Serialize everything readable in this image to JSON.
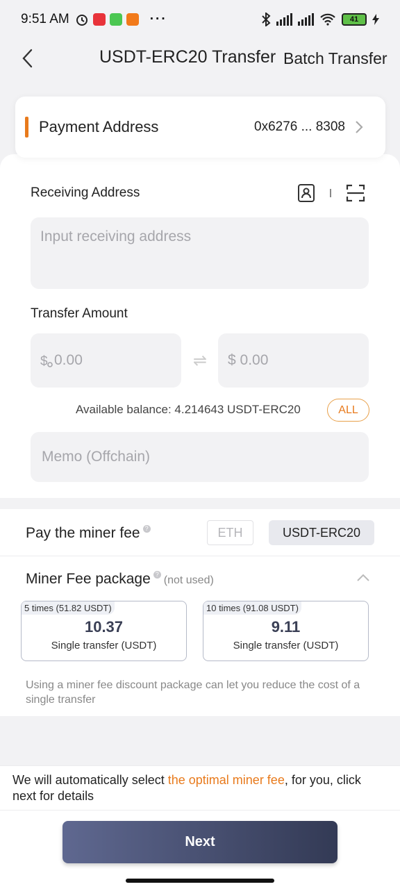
{
  "status_bar": {
    "time": "9:51 AM",
    "battery": "41"
  },
  "header": {
    "title": "USDT-ERC20 Transfer",
    "batch_transfer": "Batch Transfer"
  },
  "payment": {
    "label": "Payment Address",
    "address": "0x6276 ... 8308"
  },
  "receiving": {
    "label": "Receiving Address",
    "placeholder": "Input receiving address"
  },
  "amount": {
    "label": "Transfer Amount",
    "crypto_placeholder": "0.00",
    "fiat_placeholder": "$ 0.00",
    "available": "Available balance: 4.214643 USDT-ERC20",
    "all_label": "ALL"
  },
  "memo": {
    "placeholder": "Memo (Offchain)"
  },
  "miner_fee": {
    "label": "Pay the miner fee",
    "options": [
      "ETH",
      "USDT-ERC20"
    ],
    "selected": "USDT-ERC20"
  },
  "fee_package": {
    "label": "Miner Fee package",
    "status": "(not used)",
    "packages": [
      {
        "tag": "5 times (51.82 USDT)",
        "value": "10.37",
        "sub": "Single transfer (USDT)"
      },
      {
        "tag": "10 times (91.08 USDT)",
        "value": "9.11",
        "sub": "Single transfer (USDT)"
      }
    ],
    "note": "Using a miner fee discount package can let you reduce the cost of a single transfer"
  },
  "bottom": {
    "note_before": "We will automatically select ",
    "note_highlight": "the optimal miner fee",
    "note_after": ", for you, click next for details",
    "next_label": "Next"
  },
  "colors": {
    "accent": "#e87a1c",
    "button_start": "#5f6890",
    "button_end": "#333a55"
  }
}
